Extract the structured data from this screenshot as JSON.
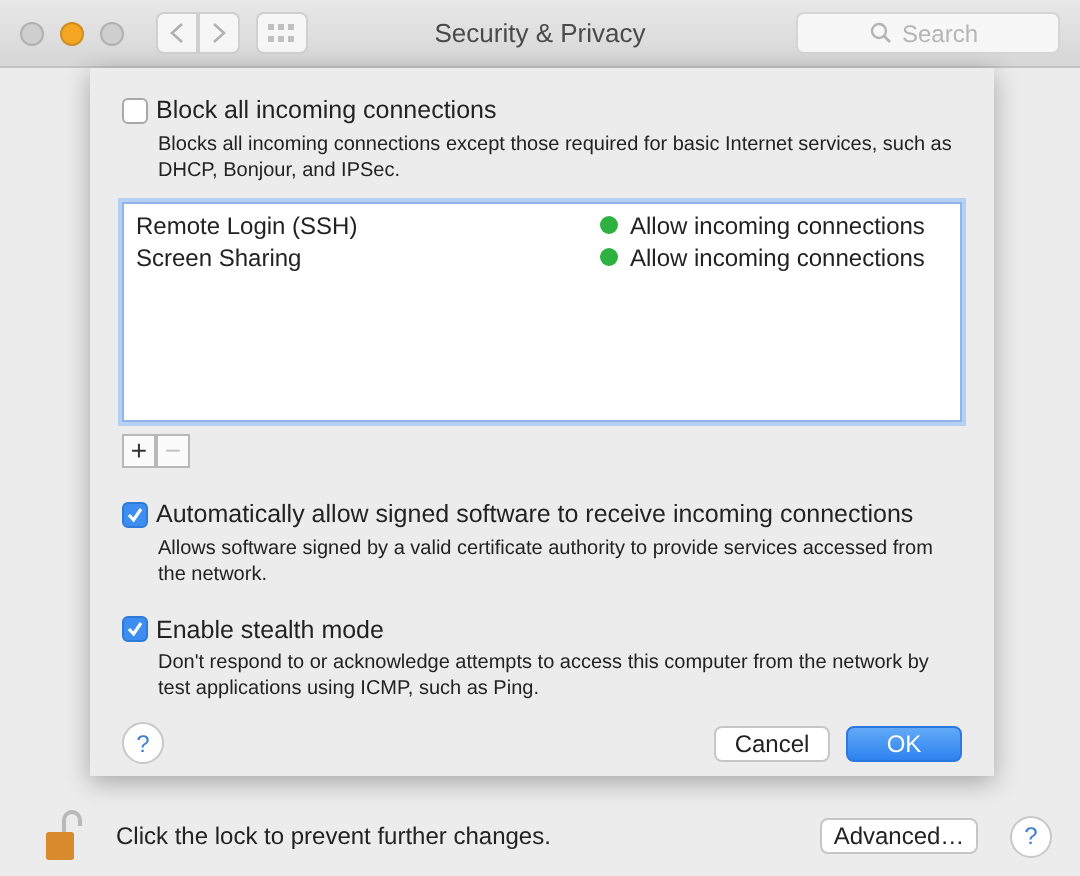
{
  "window": {
    "title": "Security & Privacy"
  },
  "search": {
    "placeholder": "Search"
  },
  "sheet": {
    "block_all": {
      "label": "Block all incoming connections",
      "checked": false,
      "description": "Blocks all incoming connections except those required for basic Internet services,  such as DHCP, Bonjour, and IPSec."
    },
    "apps": [
      {
        "name": "Remote Login (SSH)",
        "status": "Allow incoming connections"
      },
      {
        "name": "Screen Sharing",
        "status": "Allow incoming connections"
      }
    ],
    "list_buttons": [
      {
        "label": "+",
        "disabled": false
      },
      {
        "label": "−",
        "disabled": true
      }
    ],
    "options": [
      {
        "label": "Automatically allow signed software to receive incoming connections",
        "checked": true,
        "description": "Allows software signed by a valid certificate authority to provide services accessed from the network."
      },
      {
        "label": "Enable stealth mode",
        "checked": true,
        "description": "Don't respond to or acknowledge attempts to access this computer from the network by test applications using ICMP, such as Ping."
      }
    ],
    "help": "?",
    "buttons": [
      {
        "label": "Cancel",
        "default": false
      },
      {
        "label": "OK",
        "default": true
      }
    ]
  },
  "footer": {
    "lock_text": "Click the lock to prevent further changes.",
    "advanced_button": "Advanced…",
    "help": "?"
  }
}
